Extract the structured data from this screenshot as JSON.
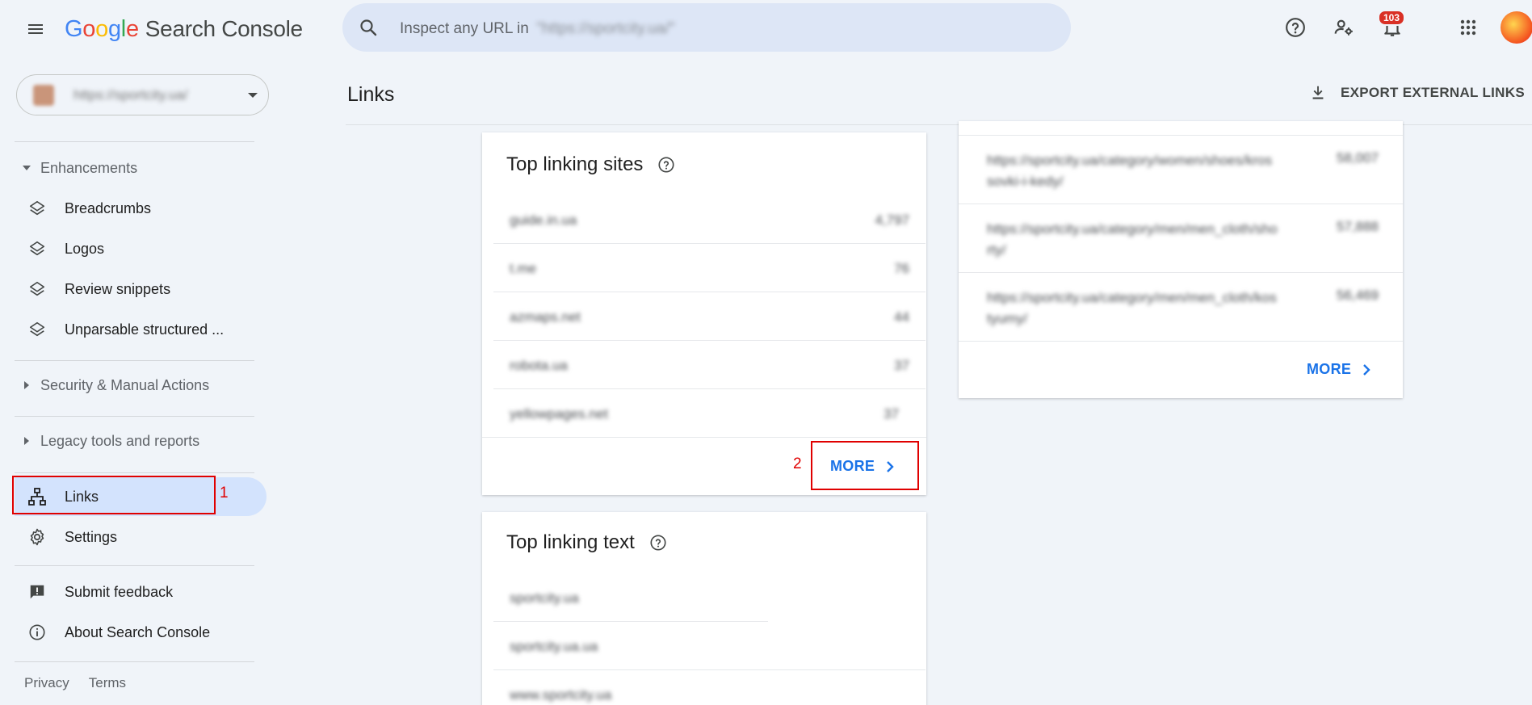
{
  "header": {
    "logo_letters": [
      "G",
      "o",
      "o",
      "g",
      "l",
      "e"
    ],
    "product_name": "Search Console",
    "search_placeholder": "Inspect any URL in",
    "search_property": "\"https://sportcity.ua/\"",
    "notification_count": "103"
  },
  "sidebar": {
    "property": "https://sportcity.ua/",
    "enhancements_heading": "Enhancements",
    "enhancements": [
      {
        "label": "Breadcrumbs",
        "icon": "layers-icon"
      },
      {
        "label": "Logos",
        "icon": "layers-icon"
      },
      {
        "label": "Review snippets",
        "icon": "layers-icon"
      },
      {
        "label": "Unparsable structured ...",
        "icon": "layers-icon"
      }
    ],
    "security_heading": "Security & Manual Actions",
    "legacy_heading": "Legacy tools and reports",
    "links_label": "Links",
    "settings_label": "Settings",
    "feedback_label": "Submit feedback",
    "about_label": "About Search Console",
    "footer": {
      "privacy": "Privacy",
      "terms": "Terms"
    }
  },
  "annotations": {
    "first": "1",
    "second": "2"
  },
  "main": {
    "title": "Links",
    "export_label": "EXPORT EXTERNAL LINKS",
    "top_linking_sites": {
      "title": "Top linking sites",
      "rows": [
        {
          "site": "guide.in.ua",
          "count": "4,797"
        },
        {
          "site": "t.me",
          "count": "76"
        },
        {
          "site": "azmaps.net",
          "count": "44"
        },
        {
          "site": "robota.ua",
          "count": "37"
        },
        {
          "site": "yellowpages.net",
          "count": "37"
        }
      ],
      "more_label": "MORE"
    },
    "top_linking_text": {
      "title": "Top linking text",
      "rows": [
        "sportcity.ua",
        "sportcity.ua.ua",
        "www.sportcity.ua"
      ]
    },
    "top_linked_pages": {
      "rows": [
        {
          "url": "https://sportcity.ua/category/women/shoes/krossovki-i-kedy/",
          "count": "58,007"
        },
        {
          "url": "https://sportcity.ua/category/men/men_cloth/shorty/",
          "count": "57,888"
        },
        {
          "url": "https://sportcity.ua/category/men/men_cloth/kostyumy/",
          "count": "56,469"
        }
      ],
      "more_label": "MORE"
    }
  },
  "colors": {
    "accent": "#1a73e8",
    "active_nav": "#d3e3fd",
    "annotation": "#e00000",
    "background": "#f0f4f9"
  }
}
